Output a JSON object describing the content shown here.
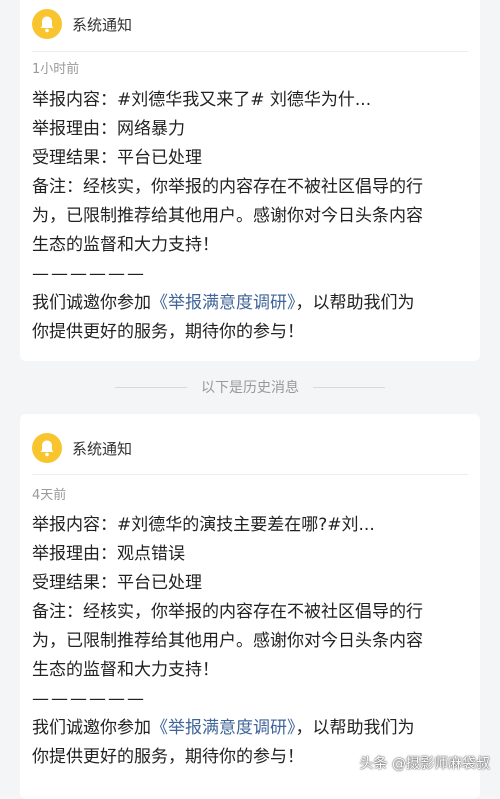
{
  "cards": [
    {
      "title": "系统通知",
      "time": "1小时前",
      "report_content": "举报内容：#刘德华我又来了# 刘德华为什...",
      "report_reason": "举报理由：网络暴力",
      "result": "受理结果：平台已处理",
      "remark_lines": [
        "备注：经核实，你举报的内容存在不被社区倡导的行",
        "为，已限制推荐给其他用户。感谢你对今日头条内容",
        "生态的监督和大力支持！"
      ],
      "dashes": "——————",
      "invite_prefix": "我们诚邀你参加",
      "survey_link": "《举报满意度调研》",
      "invite_suffix": "，以帮助我们为",
      "invite_line2": "你提供更好的服务，期待你的参与！"
    },
    {
      "title": "系统通知",
      "time": "4天前",
      "report_content": "举报内容：#刘德华的演技主要差在哪?#刘...",
      "report_reason": "举报理由：观点错误",
      "result": "受理结果：平台已处理",
      "remark_lines": [
        "备注：经核实，你举报的内容存在不被社区倡导的行",
        "为，已限制推荐给其他用户。感谢你对今日头条内容",
        "生态的监督和大力支持！"
      ],
      "dashes": "——————",
      "invite_prefix": "我们诚邀你参加",
      "survey_link": "《举报满意度调研》",
      "invite_suffix": "，以帮助我们为",
      "invite_line2": "你提供更好的服务，期待你的参与！"
    }
  ],
  "history_separator": "以下是历史消息",
  "watermark": "头条 @摄影师麻袋叔",
  "colors": {
    "bell": "#f8c52e",
    "link": "#406599",
    "background": "#f4f5f6"
  },
  "icons": {
    "notification": "bell-icon"
  }
}
